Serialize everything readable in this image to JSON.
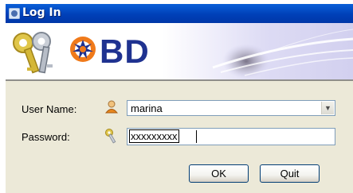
{
  "window": {
    "title": "Log In"
  },
  "banner": {
    "brand": "BD"
  },
  "form": {
    "user_label": "User Name:",
    "user_value": "marina",
    "password_label": "Password:",
    "password_value": "xxxxxxxxx"
  },
  "buttons": {
    "ok": "OK",
    "quit": "Quit"
  },
  "colors": {
    "title_bar": "#0040b8",
    "brand_blue": "#1f3290",
    "brand_orange": "#f07a1a",
    "dialog_bg": "#ece9d8"
  },
  "icons": [
    "app-icon",
    "keys-icon",
    "user-icon",
    "key-icon",
    "chevron-down-icon"
  ]
}
